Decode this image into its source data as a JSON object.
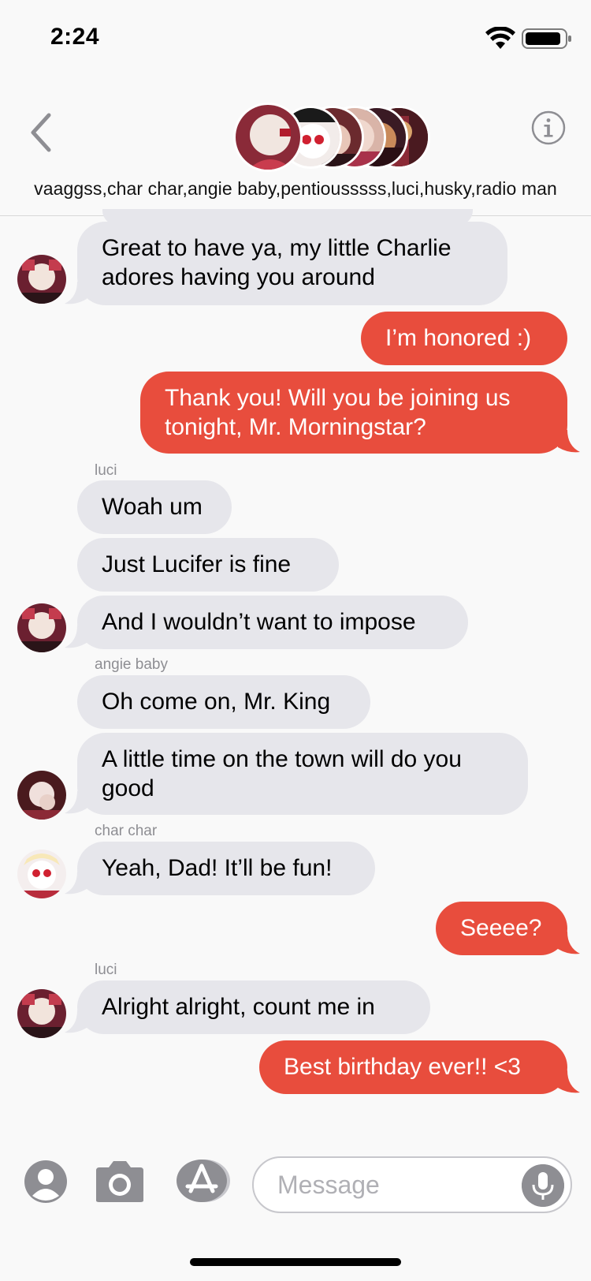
{
  "status_bar": {
    "time": "2:24",
    "battery_level": 0.85
  },
  "header": {
    "names": "vaaggss,char char,angie baby,pentiousssss,luci,husky,radio man",
    "back_icon": "chevron-left-icon",
    "info_icon": "info-circle-icon"
  },
  "messages": [
    {
      "direction": "in",
      "text": "Great to have ya, my little Charlie adores having you around",
      "line1": "Great to have ya, my little Charlie",
      "line2": "adores having you around"
    },
    {
      "direction": "out",
      "text": "I’m honored :)"
    },
    {
      "direction": "out",
      "text": "Thank you! Will you be joining us tonight, Mr. Morningstar?",
      "line1": "Thank you! Will you be joining us",
      "line2": "tonight, Mr. Morningstar?"
    },
    {
      "sender": "luci"
    },
    {
      "direction": "in",
      "text": "Woah um"
    },
    {
      "direction": "in",
      "text": "Just Lucifer is fine"
    },
    {
      "direction": "in",
      "text": "And I wouldn’t want to impose"
    },
    {
      "sender": "angie baby"
    },
    {
      "direction": "in",
      "text": "Oh come on, Mr. King"
    },
    {
      "direction": "in",
      "text": "A little time on the town will do you good",
      "line1": "A little time on the town will do you",
      "line2": "good"
    },
    {
      "sender": "char char"
    },
    {
      "direction": "in",
      "text": "Yeah, Dad! It’ll be fun!"
    },
    {
      "direction": "out",
      "text": "Seeee?"
    },
    {
      "sender": "luci"
    },
    {
      "direction": "in",
      "text": "Alright alright, count me in"
    },
    {
      "direction": "out",
      "text": "Best birthday ever!! <3"
    }
  ],
  "input_bar": {
    "placeholder": "Message"
  },
  "colors": {
    "outgoing": "#e84d3d",
    "incoming": "#e6e6eb",
    "background": "#f9f9f9",
    "sender_name": "#8e8e93"
  }
}
